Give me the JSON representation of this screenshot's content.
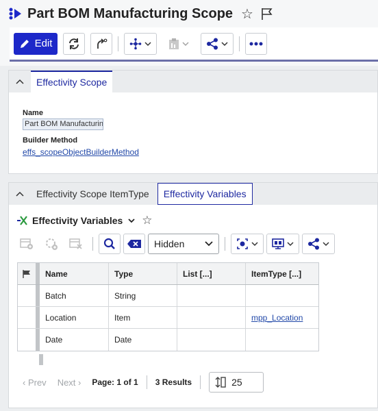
{
  "header": {
    "title": "Part BOM Manufacturing Scope",
    "edit_label": "Edit"
  },
  "panel1": {
    "tab": "Effectivity Scope",
    "name_label": "Name",
    "name_value": "Part BOM Manufacturing",
    "builder_label": "Builder Method",
    "builder_value": "effs_scopeObjectBuilderMethod"
  },
  "panel2": {
    "tabs": [
      "Effectivity Scope ItemType",
      "Effectivity Variables"
    ],
    "grid_title": "Effectivity Variables",
    "filter_value": "Hidden",
    "columns": [
      "Name",
      "Type",
      "List [...]",
      "ItemType [...]"
    ],
    "rows": [
      {
        "name": "Batch",
        "type": "String",
        "list": "",
        "itemtype": ""
      },
      {
        "name": "Location",
        "type": "Item",
        "list": "",
        "itemtype": "mpp_Location"
      },
      {
        "name": "Date",
        "type": "Date",
        "list": "",
        "itemtype": ""
      }
    ],
    "pager": {
      "prev": "Prev",
      "next": "Next",
      "page_info": "Page: 1 of 1",
      "results": "3 Results",
      "page_size": "25"
    }
  },
  "colors": {
    "accent": "#1d28c9",
    "tab_active": "#1d28a0",
    "link": "#2148a8"
  },
  "icons": [
    "logo-icon",
    "star-icon",
    "flag-icon",
    "pencil-icon",
    "refresh-icon",
    "rotate-icon",
    "structure-icon",
    "clipboard-icon",
    "share-icon",
    "more-icon",
    "chevron-up-icon",
    "add-row-icon",
    "add-icon",
    "delete-row-icon",
    "search-icon",
    "clear-icon",
    "camera-icon",
    "layout-icon",
    "flag-column-icon",
    "page-size-icon"
  ]
}
